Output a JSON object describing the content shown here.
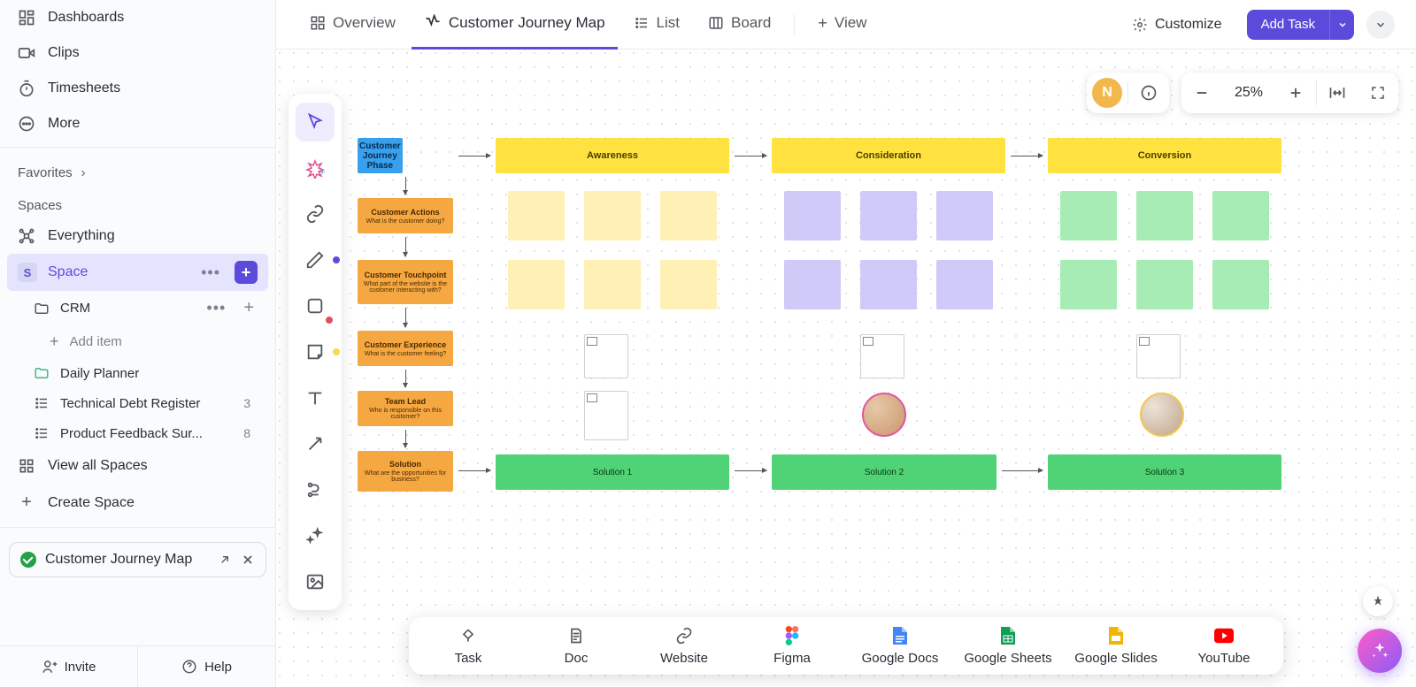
{
  "sidebar": {
    "nav": {
      "dashboards": "Dashboards",
      "clips": "Clips",
      "timesheets": "Timesheets",
      "more": "More"
    },
    "favorites_label": "Favorites",
    "spaces_label": "Spaces",
    "everything": "Everything",
    "space_name": "Space",
    "space_initial": "S",
    "crm": "CRM",
    "add_item": "Add item",
    "daily_planner": "Daily Planner",
    "tech_debt": "Technical Debt Register",
    "tech_debt_count": "3",
    "feedback": "Product Feedback Sur...",
    "feedback_count": "8",
    "view_all": "View all Spaces",
    "create_space": "Create Space",
    "pill_label": "Customer Journey Map",
    "invite": "Invite",
    "help": "Help"
  },
  "tabs": {
    "overview": "Overview",
    "journey": "Customer Journey Map",
    "list": "List",
    "board": "Board",
    "view": "View",
    "customize": "Customize",
    "add_task": "Add Task"
  },
  "canvas": {
    "zoom": "25%",
    "user_initial": "N",
    "phase_header": "Customer Journey Phase",
    "phases": [
      "Awareness",
      "Consideration",
      "Conversion"
    ],
    "rows": [
      {
        "title": "Customer Actions",
        "sub": "What is the customer doing?"
      },
      {
        "title": "Customer Touchpoint",
        "sub": "What part of the website is the customer interacting with?"
      },
      {
        "title": "Customer Experience",
        "sub": "What is the customer feeling?"
      },
      {
        "title": "Team Lead",
        "sub": "Who is responsible on this customer?"
      },
      {
        "title": "Solution",
        "sub": "What are the opportunities for business?"
      }
    ],
    "solutions": [
      "Solution 1",
      "Solution 2",
      "Solution 3"
    ]
  },
  "dock": {
    "task": "Task",
    "doc": "Doc",
    "website": "Website",
    "figma": "Figma",
    "gdocs": "Google Docs",
    "gsheets": "Google Sheets",
    "gslides": "Google Slides",
    "youtube": "YouTube"
  }
}
